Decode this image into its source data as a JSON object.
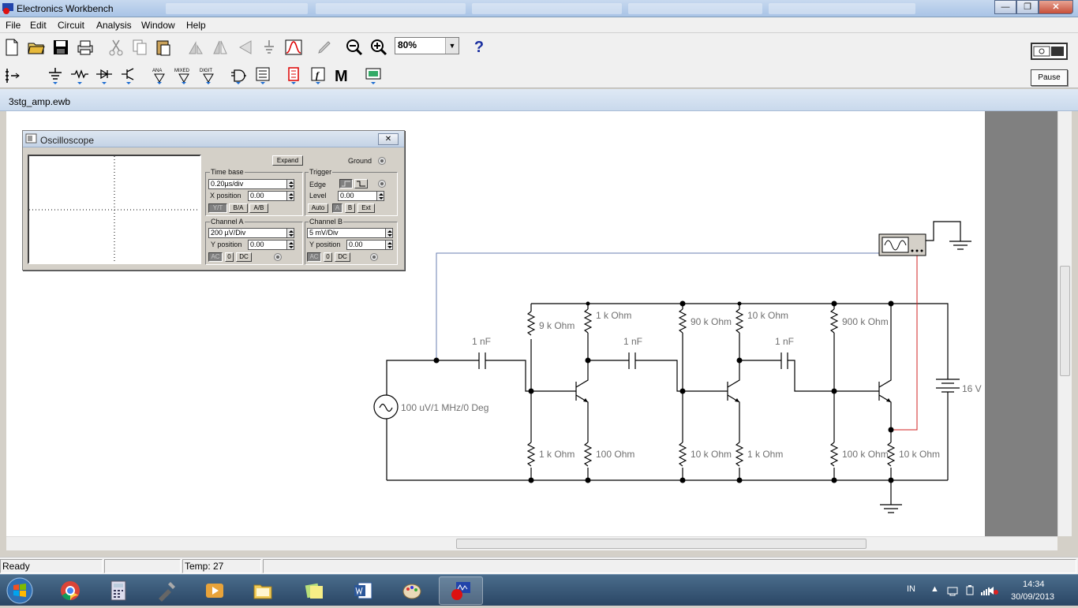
{
  "window": {
    "title": "Electronics Workbench",
    "minimize": "—",
    "maximize": "❐",
    "close": "✕"
  },
  "menu": [
    "File",
    "Edit",
    "Circuit",
    "Analysis",
    "Window",
    "Help"
  ],
  "toolbar": {
    "zoom_value": "80%",
    "help_label": "?",
    "pause_label": "Pause",
    "parts_labels": {
      "analog": "ANA",
      "mixed": "MIXED",
      "digital": "DIGIT",
      "misc_m": "M",
      "func_f": "f"
    }
  },
  "document": {
    "tab_title": "3stg_amp.ewb"
  },
  "oscilloscope": {
    "title": "Oscilloscope",
    "close": "✕",
    "expand_label": "Expand",
    "ground_label": "Ground",
    "time_base": {
      "title": "Time base",
      "value": "0.20µs/div",
      "x_position_label": "X position",
      "x_position": "0.00",
      "modes": [
        "Y/T",
        "B/A",
        "A/B"
      ]
    },
    "trigger": {
      "title": "Trigger",
      "edge_label": "Edge",
      "level_label": "Level",
      "level": "0.00",
      "sources": [
        "Auto",
        "A",
        "B",
        "Ext"
      ]
    },
    "channel_a": {
      "title": "Channel A",
      "value": "200 µV/Div",
      "y_position_label": "Y position",
      "y_position": "0.00",
      "coupling": [
        "AC",
        "0",
        "DC"
      ]
    },
    "channel_b": {
      "title": "Channel B",
      "value": "5 mV/Div",
      "y_position_label": "Y position",
      "y_position": "0.00",
      "coupling": [
        "AC",
        "0",
        "DC"
      ]
    }
  },
  "circuit": {
    "source": "100 uV/1 MHz/0 Deg",
    "caps": [
      "1 nF",
      "1 nF",
      "1 nF"
    ],
    "resistors_top": [
      "9 k Ohm",
      "1 k Ohm",
      "90 k Ohm",
      "10 k Ohm",
      "900 k Ohm"
    ],
    "resistors_bottom": [
      "1 k Ohm",
      "100  Ohm",
      "10 k Ohm",
      "1 k Ohm",
      "100 k Ohm",
      "10 k Ohm"
    ],
    "battery": "16 V"
  },
  "status": {
    "ready": "Ready",
    "temp_label": "Temp:  27"
  },
  "taskbar": {
    "language": "IN",
    "time": "14:34",
    "date": "30/09/2013"
  },
  "colors": {
    "wire": "#000000",
    "probe_a": "#6a7fb0",
    "probe_b": "#d02020",
    "component_label": "#707070"
  }
}
